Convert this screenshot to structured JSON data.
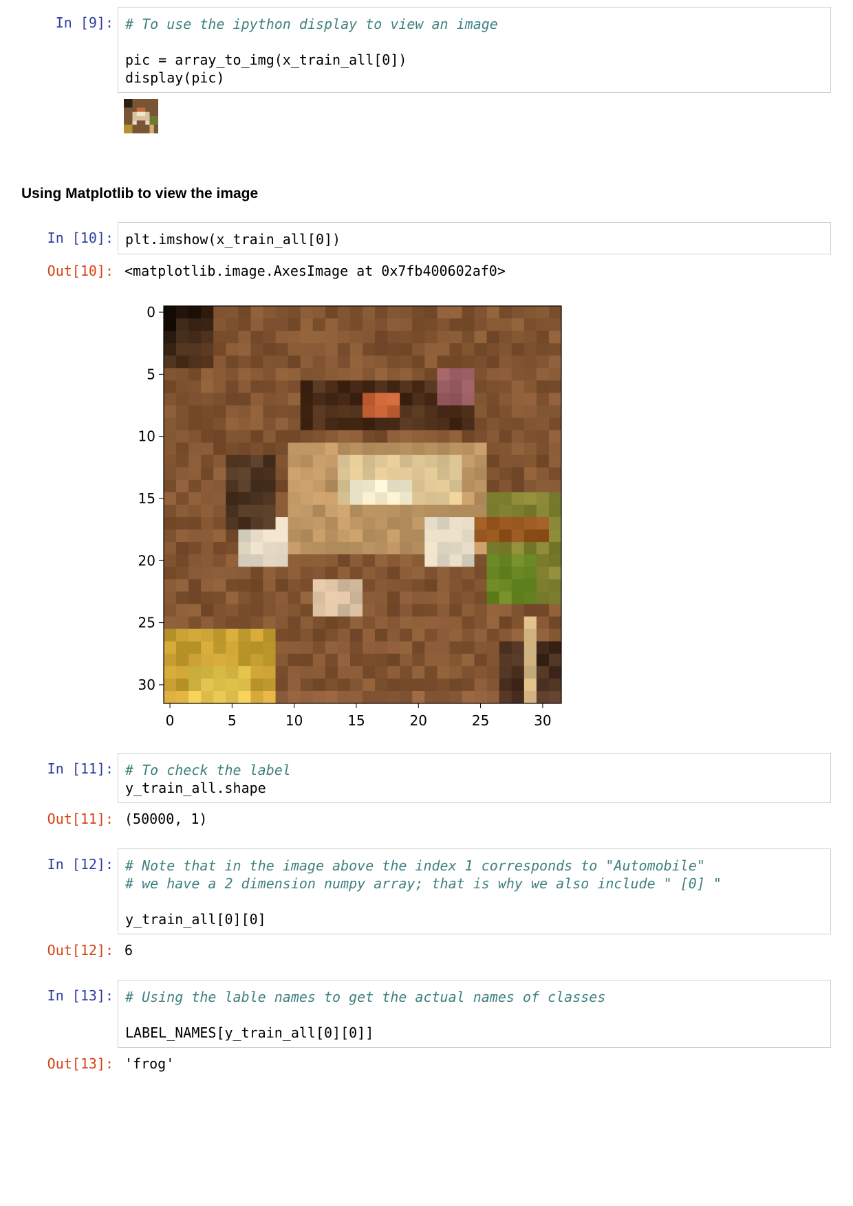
{
  "cells": [
    {
      "id": "cell9",
      "in_prompt": "In [9]:",
      "lines": [
        {
          "text": "# To use the ipython display to view an image",
          "kind": "comment"
        },
        {
          "text": "",
          "kind": "blank"
        },
        {
          "text": "pic = array_to_img(x_train_all[0])",
          "kind": "code"
        },
        {
          "text": "display(pic)",
          "kind": "code"
        }
      ]
    },
    {
      "id": "cell10",
      "in_prompt": "In [10]:",
      "lines": [
        {
          "text": "plt.imshow(x_train_all[0])",
          "kind": "code"
        }
      ],
      "out_prompt": "Out[10]:",
      "output": "<matplotlib.image.AxesImage at 0x7fb400602af0>"
    },
    {
      "id": "cell11",
      "in_prompt": "In [11]:",
      "lines": [
        {
          "text": "# To check the label",
          "kind": "comment"
        },
        {
          "text": "y_train_all.shape",
          "kind": "code"
        }
      ],
      "out_prompt": "Out[11]:",
      "output": "(50000, 1)"
    },
    {
      "id": "cell12",
      "in_prompt": "In [12]:",
      "lines": [
        {
          "text": "# Note that in the image above the index 1 corresponds to \"Automobile\"",
          "kind": "comment"
        },
        {
          "text": "# we have a 2 dimension numpy array; that is why we also include \" [0] \"",
          "kind": "comment"
        },
        {
          "text": "",
          "kind": "blank"
        },
        {
          "text": "y_train_all[0][0]",
          "kind": "code"
        }
      ],
      "out_prompt": "Out[12]:",
      "output": "6"
    },
    {
      "id": "cell13",
      "in_prompt": "In [13]:",
      "lines": [
        {
          "text": "# Using the lable names to get the actual names of classes",
          "kind": "comment"
        },
        {
          "text": "",
          "kind": "blank"
        },
        {
          "text": "LABEL_NAMES[y_train_all[0][0]]",
          "kind": "code"
        }
      ],
      "out_prompt": "Out[13]:",
      "output": "'frog'"
    }
  ],
  "markdown_heading": "Using Matplotlib to view the image",
  "colors": {
    "prompt_in": "#303f9f",
    "prompt_out": "#d84315",
    "comment": "#408080",
    "cell_border": "#cfcfcf"
  },
  "chart_data": {
    "type": "heatmap",
    "description_of_content": "32x32 pixel frog image shown with imshow",
    "x_ticks": [
      "0",
      "5",
      "10",
      "15",
      "20",
      "25",
      "30"
    ],
    "y_ticks": [
      "0",
      "5",
      "10",
      "15",
      "20",
      "25",
      "30"
    ],
    "x_tick_values": [
      0,
      5,
      10,
      15,
      20,
      25,
      30
    ],
    "y_tick_values": [
      0,
      5,
      10,
      15,
      20,
      25,
      30
    ],
    "xlim": [
      -0.5,
      31.5
    ],
    "ylim": [
      31.5,
      -0.5
    ],
    "title": "",
    "xlabel": "",
    "ylabel": ""
  }
}
